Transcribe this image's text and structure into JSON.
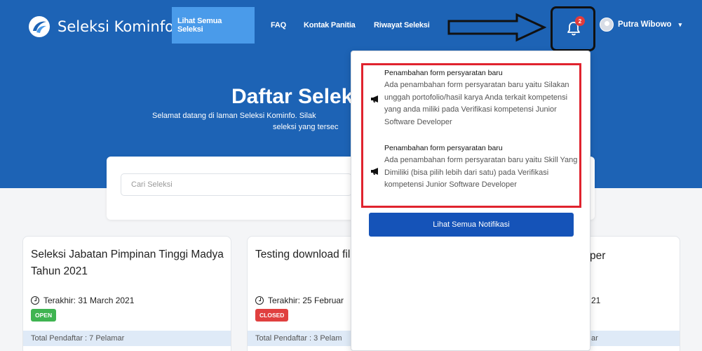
{
  "brand": {
    "name": "Seleksi Kominfo"
  },
  "nav": {
    "items": [
      {
        "label": "Lihat Semua Seleksi",
        "active": true
      },
      {
        "label": "FAQ"
      },
      {
        "label": "Kontak Panitia"
      },
      {
        "label": "Riwayat Seleksi"
      }
    ]
  },
  "notifications_badge": "2",
  "user": {
    "name": "Putra Wibowo"
  },
  "hero": {
    "title": "Daftar Selek",
    "subtitle_line1": "Selamat datang di laman Seleksi Kominfo. Silak",
    "subtitle_line2": "seleksi yang tersec"
  },
  "search": {
    "placeholder": "Cari Seleksi"
  },
  "cards": [
    {
      "title": "Seleksi Jabatan Pimpinan Tinggi Madya Tahun 2021",
      "date": "Terakhir: 31 March 2021",
      "status": "OPEN",
      "footer": "Total Pendaftar : 7 Pelamar"
    },
    {
      "title": "Testing download fil",
      "date": "Terakhir: 25 Februar",
      "status": "CLOSED",
      "footer": "Total Pendaftar : 3 Pelam"
    },
    {
      "title": "per",
      "date": "21",
      "status": "",
      "footer": "ar"
    }
  ],
  "dropdown": {
    "notifications": [
      {
        "title": "Penambahan form persyaratan baru",
        "body": "Ada penambahan form persyaratan baru yaitu Silakan unggah portofolio/hasil karya Anda terkait kompetensi yang anda miliki pada Verifikasi kompetensi Junior Software Developer"
      },
      {
        "title": "Penambahan form persyaratan baru",
        "body": "Ada penambahan form persyaratan baru yaitu Skill Yang Dimiliki (bisa pilih lebih dari satu) pada Verifikasi kompetensi Junior Software Developer"
      }
    ],
    "see_all_label": "Lihat Semua Notifikasi"
  },
  "colors": {
    "hero_bg": "#1d63b5",
    "nav_active_bg": "#4a9bea",
    "badge_red": "#e23b3b",
    "open_green": "#3fb451",
    "closed_red": "#e0403f",
    "button_blue": "#1553b8",
    "highlight_red": "#e0232e"
  },
  "icons": [
    "brand-logo-icon",
    "bell-icon",
    "avatar-icon",
    "chevron-down-icon",
    "clock-icon",
    "megaphone-icon",
    "arrow-annotation-icon"
  ]
}
